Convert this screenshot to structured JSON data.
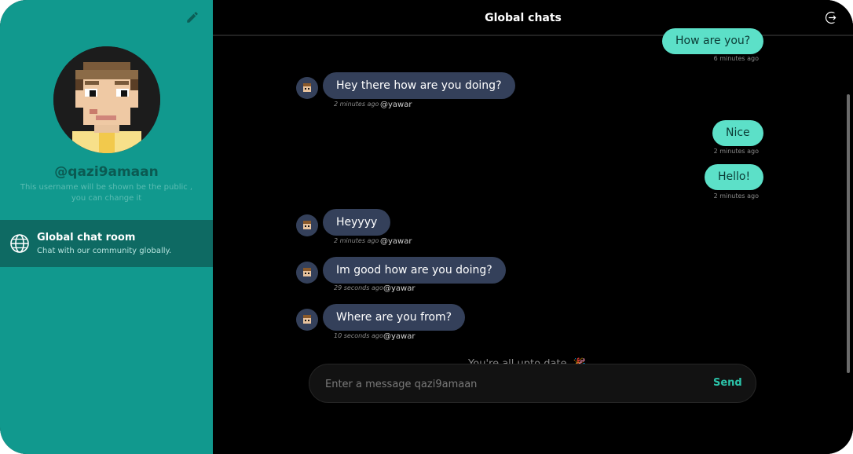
{
  "sidebar": {
    "username": "@qazi9amaan",
    "username_note": "This username will be shown be the public , you can change it",
    "room": {
      "title": "Global chat room",
      "subtitle": "Chat with our community globally."
    },
    "icons": [
      "pencil-icon",
      "globe-icon"
    ]
  },
  "header": {
    "title": "Global chats",
    "icon": "logout-icon"
  },
  "messages": [
    {
      "dir": "out",
      "text": "How are you?",
      "time": "6 minutes ago"
    },
    {
      "dir": "in",
      "text": "Hey there how are you doing?",
      "time": "2 minutes ago",
      "user": "@yawar"
    },
    {
      "dir": "out",
      "text": "Nice",
      "time": "2 minutes ago"
    },
    {
      "dir": "out",
      "text": "Hello!",
      "time": "2 minutes ago"
    },
    {
      "dir": "in",
      "text": "Heyyyy",
      "time": "2 minutes ago",
      "user": "@yawar"
    },
    {
      "dir": "in",
      "text": "Im good how are you doing?",
      "time": "29 seconds ago",
      "user": "@yawar"
    },
    {
      "dir": "in",
      "text": "Where are you from?",
      "time": "10 seconds ago",
      "user": "@yawar"
    }
  ],
  "status": "You're all upto date. 🎉",
  "composer": {
    "placeholder": "Enter a message qazi9amaan",
    "send_label": "Send"
  },
  "colors": {
    "sidebar": "#11998e",
    "sidebar_active": "#0e6a63",
    "bubble_out": "#5ce0c8",
    "bubble_in": "#34405a",
    "send": "#2bc2a8"
  }
}
